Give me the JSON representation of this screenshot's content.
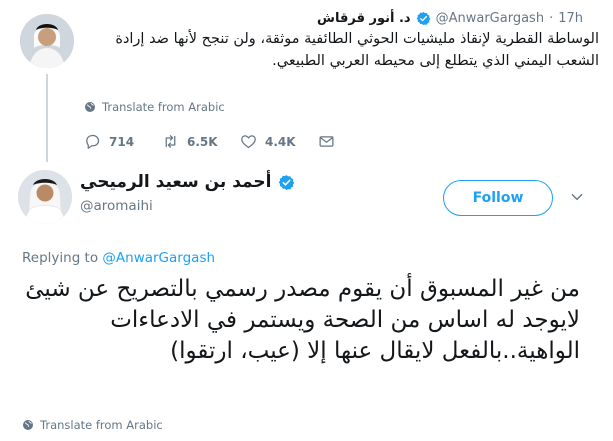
{
  "parent_tweet": {
    "display_name": "د. أنور قرقاش",
    "handle": "@AnwarGargash",
    "separator": "·",
    "time": "17h",
    "text": "الوساطة القطرية لإنقاذ مليشيات الحوثي الطائفية موثقة، ولن تنجح لأنها ضد إرادة الشعب اليمني الذي يتطلع إلى محيطه العربي الطبيعي.",
    "translate_label": "Translate from Arabic",
    "replies": "714",
    "retweets": "6.5K",
    "likes": "4.4K",
    "icons": {
      "reply": "reply-icon",
      "retweet": "retweet-icon",
      "like": "heart-icon",
      "dm": "envelope-icon",
      "verified": "verified-badge-icon",
      "translate": "globe-icon"
    }
  },
  "main_tweet": {
    "display_name": "أحمد بن سعيد الرميحي",
    "handle": "@aromaihi",
    "follow_label": "Follow",
    "replying_prefix": "Replying to",
    "replying_to": "@AnwarGargash",
    "text": "من غير المسبوق أن يقوم مصدر رسمي بالتصريح عن شيئ لايوجد له اساس من الصحة ويستمر في الادعاءات الواهية..بالفعل لايقال عنها إلا (عيب، ارتقوا)",
    "translate_label": "Translate from Arabic",
    "icons": {
      "verified": "verified-badge-icon",
      "menu": "chevron-down-icon",
      "translate": "globe-icon"
    }
  },
  "colors": {
    "accent": "#1da1f2",
    "text": "#14171a",
    "muted": "#657786",
    "thread_line": "#ccd6dd"
  }
}
